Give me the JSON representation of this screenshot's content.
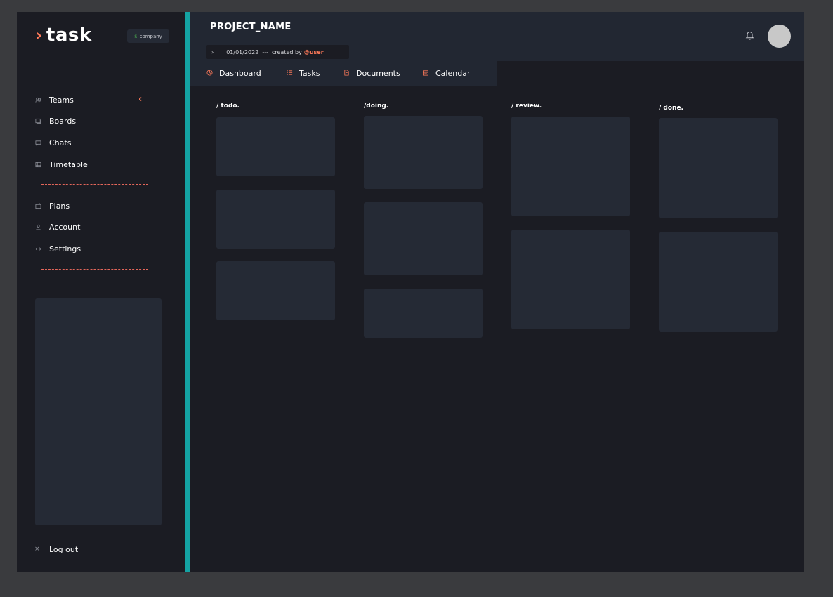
{
  "app": {
    "logo_text": "task",
    "company_badge": "company"
  },
  "sidebar": {
    "items_top": [
      {
        "label": "Teams",
        "icon": "users-icon"
      },
      {
        "label": "Boards",
        "icon": "board-icon"
      },
      {
        "label": "Chats",
        "icon": "chat-icon"
      },
      {
        "label": "Timetable",
        "icon": "grid-icon"
      }
    ],
    "items_bottom": [
      {
        "label": "Plans",
        "icon": "wallet-icon"
      },
      {
        "label": "Account",
        "icon": "user-icon"
      },
      {
        "label": "Settings",
        "icon": "code-icon"
      }
    ],
    "logout_label": "Log out"
  },
  "header": {
    "project_name": "PROJECT_NAME",
    "date": "01/01/2022",
    "separator": "---",
    "created_by": "created by",
    "user": "@user"
  },
  "tabs": [
    {
      "label": "Dashboard",
      "icon": "dashboard-icon"
    },
    {
      "label": "Tasks",
      "icon": "list-icon"
    },
    {
      "label": "Documents",
      "icon": "document-icon"
    },
    {
      "label": "Calendar",
      "icon": "calendar-icon"
    }
  ],
  "board": {
    "columns": [
      {
        "title": "/ todo.",
        "card_count": 3
      },
      {
        "title": "/doing.",
        "card_count": 3
      },
      {
        "title": "/ review.",
        "card_count": 2
      },
      {
        "title": "/ done.",
        "card_count": 2
      }
    ]
  },
  "colors": {
    "background": "#1b1c23",
    "panel": "#252a35",
    "header": "#222732",
    "accent": "#ff7a59",
    "teal": "#14a3a3"
  }
}
